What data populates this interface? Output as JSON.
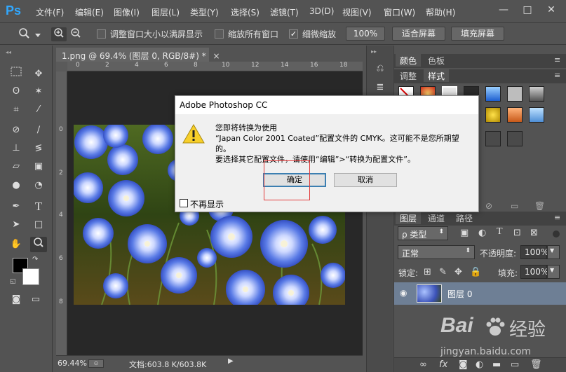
{
  "app": {
    "logo": "Ps",
    "menu": [
      "文件(F)",
      "编辑(E)",
      "图像(I)",
      "图层(L)",
      "类型(Y)",
      "选择(S)",
      "滤镜(T)",
      "3D(D)",
      "视图(V)",
      "窗口(W)",
      "帮助(H)"
    ],
    "window_controls": [
      "—",
      "□",
      "✕"
    ]
  },
  "options": {
    "chk_resize_label": "调整窗口大小以满屏显示",
    "chk_resize": false,
    "chk_zoom_all_label": "缩放所有窗口",
    "chk_zoom_all": false,
    "chk_scrubby_label": "细微缩放",
    "chk_scrubby": true,
    "btn_100": "100%",
    "btn_fit": "适合屏幕",
    "btn_fill": "填充屏幕"
  },
  "document": {
    "tab_title": "1.png @ 69.4% (图层 0, RGB/8#) *",
    "tab_close": "×",
    "ruler_ticks": [
      "0",
      "2",
      "4",
      "6",
      "8",
      "10",
      "12",
      "14",
      "16",
      "18"
    ],
    "ruler_left_ticks": [
      "0",
      "2",
      "4",
      "6",
      "8"
    ],
    "zoom": "69.44%",
    "doc_size": "文档:603.8 K/603.8K"
  },
  "panels": {
    "color_tabs": [
      "颜色",
      "色板"
    ],
    "style_tabs": [
      "调整",
      "样式"
    ],
    "layer_tabs": [
      "图层",
      "通道",
      "路径"
    ],
    "filter_kind": "ρ 类型",
    "blend_mode": "正常",
    "opacity_label": "不透明度:",
    "opacity": "100%",
    "lock_label": "锁定:",
    "fill_label": "填充:",
    "fill": "100%",
    "layer_name": "图层 0"
  },
  "dialog": {
    "title": "Adobe Photoshop CC",
    "line1": "您即将转换为使用",
    "line2": "“Japan Color 2001 Coated”配置文件的 CMYK。这可能不是您所期望",
    "line3": "的。",
    "line4": "要选择其它配置文件，请使用“编辑”>“转换为配置文件”。",
    "ok": "确定",
    "cancel": "取消",
    "dont_show": "不再显示",
    "dont_show_checked": false
  },
  "watermark": {
    "brand": "Bai",
    "brand2": "经验",
    "url": "jingyan.baidu.com"
  },
  "colors": {
    "ps_blue": "#31a8ff",
    "ui_gray": "#535353",
    "dialog_bg": "#f0f0f0",
    "highlight_red": "#e23a3a",
    "layer_selected": "#7c8ea4"
  }
}
